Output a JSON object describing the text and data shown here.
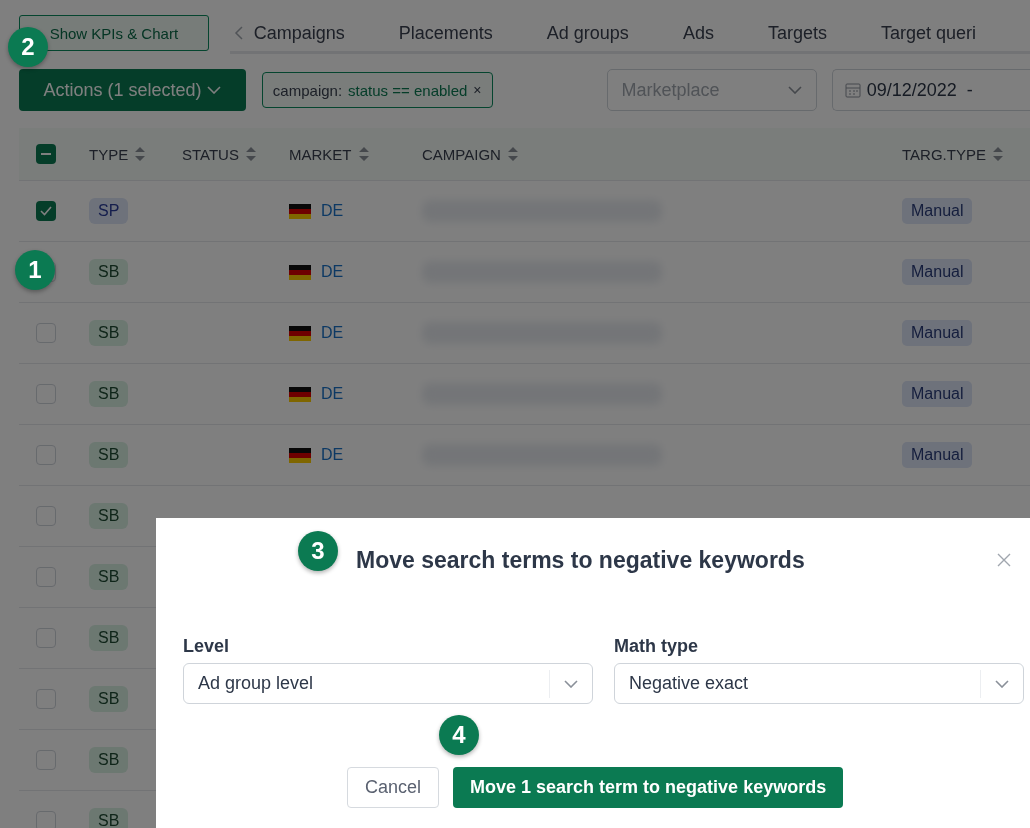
{
  "toolbar": {
    "kpi_button": "Show KPIs & Chart",
    "tabs": [
      {
        "label": "Campaigns",
        "selected": false
      },
      {
        "label": "Placements",
        "selected": false
      },
      {
        "label": "Ad groups",
        "selected": false
      },
      {
        "label": "Ads",
        "selected": false
      },
      {
        "label": "Targets",
        "selected": false
      },
      {
        "label": "Target queri",
        "selected": false
      }
    ]
  },
  "filters": {
    "actions_button": "Actions (1 selected)",
    "chip": {
      "field": "campaign:",
      "value": "status == enabled",
      "remove": "×"
    },
    "marketplace": {
      "placeholder": "Marketplace"
    },
    "date": {
      "value": "09/12/2022  -"
    }
  },
  "table": {
    "select_all": {
      "indeterminate": true
    },
    "columns": [
      "TYPE",
      "STATUS",
      "MARKET",
      "CAMPAIGN",
      "TARG.TYPE"
    ],
    "rows": [
      {
        "checked": true,
        "type": "SP",
        "kind": "sp",
        "market": "DE",
        "campaign": {
          "kind": "redacted"
        },
        "targ_type": "Manual"
      },
      {
        "checked": false,
        "type": "SB",
        "kind": "sb",
        "market": "DE",
        "campaign": {
          "kind": "redacted"
        },
        "targ_type": "Manual"
      },
      {
        "checked": false,
        "type": "SB",
        "kind": "sb",
        "market": "DE",
        "campaign": {
          "kind": "redacted"
        },
        "targ_type": "Manual"
      },
      {
        "checked": false,
        "type": "SB",
        "kind": "sb",
        "market": "DE",
        "campaign": {
          "kind": "redacted"
        },
        "targ_type": "Manual"
      },
      {
        "checked": false,
        "type": "SB",
        "kind": "sb",
        "market": "DE",
        "campaign": {
          "kind": "redacted"
        },
        "targ_type": "Manual"
      },
      {
        "checked": false,
        "type": "SB",
        "kind": "sb"
      },
      {
        "checked": false,
        "type": "SB",
        "kind": "sb"
      },
      {
        "checked": false,
        "type": "SB",
        "kind": "sb"
      },
      {
        "checked": false,
        "type": "SB",
        "kind": "sb"
      },
      {
        "checked": false,
        "type": "SB",
        "kind": "sb"
      },
      {
        "checked": false,
        "type": "SB",
        "kind": "sb"
      }
    ]
  },
  "dialog": {
    "title": "Move search terms to negative keywords",
    "fields": [
      {
        "label": "Level",
        "value": "Ad group level"
      },
      {
        "label": "Math type",
        "value": "Negative exact"
      }
    ],
    "buttons": [
      {
        "label": "Cancel",
        "kind": "secondary"
      },
      {
        "label": "Move 1 search term to negative keywords",
        "kind": "primary"
      }
    ]
  },
  "step_markers": [
    "1",
    "2",
    "3",
    "4"
  ]
}
